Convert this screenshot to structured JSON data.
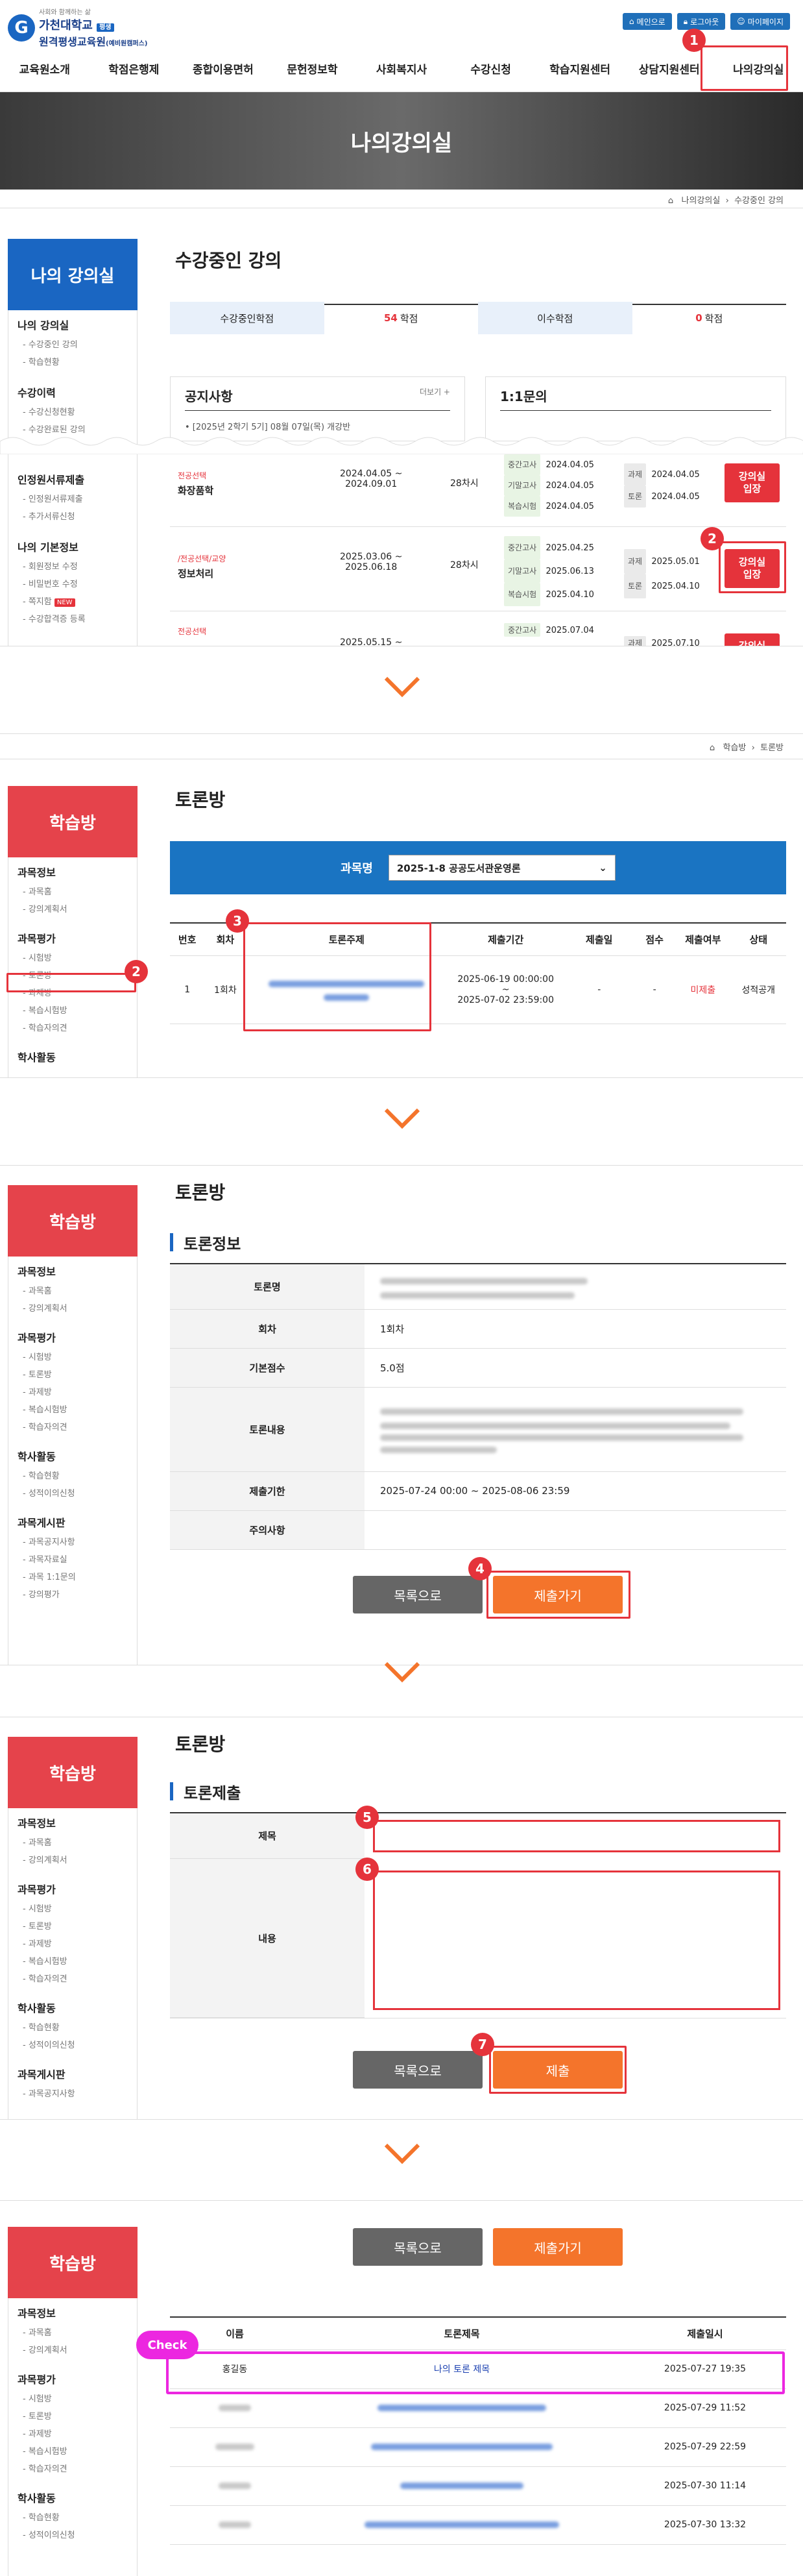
{
  "header": {
    "logo_small": "사회와 함께하는 삶",
    "logo_main": "가천대학교",
    "logo_badge": "평생",
    "logo_sub": "원격평생교육원",
    "logo_sub2": "(예비원캠퍼스)",
    "btn1": "메인으로",
    "btn2": "로그아웃",
    "btn3": "마이페이지"
  },
  "nav": [
    "교육원소개",
    "학점은행제",
    "종합이용면허",
    "문헌정보학",
    "사회복지사",
    "수강신청",
    "학습지원센터",
    "상담지원센터",
    "나의강의실"
  ],
  "banner_title": "나의강의실",
  "s1": {
    "crumb1": "나의강의실",
    "crumb2": "수강중인 강의",
    "side_title": "나의 강의실",
    "side": [
      {
        "g": "나의 강의실",
        "items": [
          "수강중인 강의",
          "학습현황"
        ]
      },
      {
        "g": "수강이력",
        "items": [
          "수강신청현황",
          "수강완료된 강의"
        ]
      },
      {
        "g": "인정원서류제출",
        "items": [
          "인정원서류제출",
          "추가서류신청"
        ]
      },
      {
        "g": "나의 기본정보",
        "items": [
          "회원정보 수정",
          "비밀번호 수정",
          "쪽지함",
          "수강합격증 등록"
        ]
      }
    ],
    "new_badge": "NEW",
    "title": "수강중인 강의",
    "credit_l": "수강중인학점",
    "credit_lv": "54",
    "credit_unit": "학점",
    "credit_r": "이수학점",
    "credit_rv": "0",
    "credit_unit2": "학점",
    "notice_title": "공지사항",
    "more": "더보기 +",
    "notice_item": "• [2025년 2학기 5기] 08월 07일(목) 개강반",
    "qa_title": "1:1문의",
    "rows": [
      {
        "cat": "전공선택",
        "name": "화장품학",
        "period1": "2024.04.05 ~",
        "period2": "2024.09.01",
        "sessions": "28차시",
        "tags": [
          "중간고사",
          "기말고사",
          "복습시험"
        ],
        "tdates": [
          "2024.04.05",
          "2024.04.05",
          "2024.04.05"
        ],
        "tags2": [
          "과제",
          "토론"
        ],
        "t2dates": [
          "2024.04.05",
          "2024.04.05"
        ],
        "btn": "강의실\n입장"
      },
      {
        "cat": "/전공선택/교양",
        "name": "정보처리",
        "period1": "2025.03.06 ~",
        "period2": "2025.06.18",
        "sessions": "28차시",
        "tags": [
          "중간고사",
          "기말고사",
          "복습시험"
        ],
        "tdates": [
          "2025.04.25",
          "2025.06.13",
          "2025.04.10"
        ],
        "tags2": [
          "과제",
          "토론"
        ],
        "t2dates": [
          "2025.05.01",
          "2025.04.10"
        ],
        "btn": "강의실\n입장"
      },
      {
        "cat": "전공선택",
        "name": "",
        "period1": "2025.05.15 ~",
        "period2": "",
        "sessions": "",
        "tags": [
          "중간고사"
        ],
        "tdates": [
          "2025.07.04"
        ],
        "tags2": [
          "과제"
        ],
        "t2dates": [
          "2025.07.10"
        ],
        "btn": "강의실"
      }
    ]
  },
  "learn": {
    "side_title": "학습방",
    "crumb1": "학습방",
    "crumb2": "토론방"
  },
  "s2": {
    "side": [
      {
        "g": "과목정보",
        "items": [
          "과목홈",
          "강의계획서"
        ]
      },
      {
        "g": "과목평가",
        "items": [
          "시험방",
          "토론방",
          "과제방",
          "복습시험방",
          "학습자의견"
        ]
      },
      {
        "g": "학사활동",
        "items": []
      }
    ],
    "title": "토론방",
    "subject_label": "과목명",
    "subject_value": "2025-1-8 공공도서관운영론",
    "cols": [
      "번호",
      "회차",
      "토론주제",
      "제출기간",
      "제출일",
      "점수",
      "제출여부",
      "상태"
    ],
    "row": {
      "no": "1",
      "round": "1회차",
      "p1": "2025-06-19 00:00:00",
      "p2": "~",
      "p3": "2025-07-02 23:59:00",
      "date": "-",
      "score": "-",
      "status": "미제출",
      "state": "성적공개"
    }
  },
  "s3": {
    "side": [
      {
        "g": "과목정보",
        "items": [
          "과목홈",
          "강의계획서"
        ]
      },
      {
        "g": "과목평가",
        "items": [
          "시험방",
          "토론방",
          "과제방",
          "복습시험방",
          "학습자의견"
        ]
      },
      {
        "g": "학사활동",
        "items": [
          "학습현황",
          "성적이의신청"
        ]
      },
      {
        "g": "과목게시판",
        "items": [
          "과목공지사항",
          "과목자료실",
          "과목 1:1문의",
          "강의평가"
        ]
      }
    ],
    "title": "토론방",
    "sub": "토론정보",
    "labels": [
      "토론명",
      "회차",
      "기본점수",
      "토론내용",
      "제출기한",
      "주의사항"
    ],
    "round": "1회차",
    "score": "5.0점",
    "deadline": "2025-07-24 00:00 ~ 2025-08-06 23:59",
    "btn_list": "목록으로",
    "btn_submit": "제출가기"
  },
  "s4": {
    "side": [
      {
        "g": "과목정보",
        "items": [
          "과목홈",
          "강의계획서"
        ]
      },
      {
        "g": "과목평가",
        "items": [
          "시험방",
          "토론방",
          "과제방",
          "복습시험방",
          "학습자의견"
        ]
      },
      {
        "g": "학사활동",
        "items": [
          "학습현황",
          "성적이의신청"
        ]
      },
      {
        "g": "과목게시판",
        "items": [
          "과목공지사항"
        ]
      }
    ],
    "title": "토론방",
    "sub": "토론제출",
    "label_title": "제목",
    "label_content": "내용",
    "btn_list": "목록으로",
    "btn_submit": "제출"
  },
  "s5": {
    "side": [
      {
        "g": "과목정보",
        "items": [
          "과목홈",
          "강의계획서"
        ]
      },
      {
        "g": "과목평가",
        "items": [
          "시험방",
          "토론방",
          "과제방",
          "복습시험방",
          "학습자의견"
        ]
      },
      {
        "g": "학사활동",
        "items": [
          "학습현황",
          "성적이의신청"
        ]
      }
    ],
    "btn_list": "목록으로",
    "btn_submit": "제출가기",
    "check": "Check",
    "cols": [
      "이름",
      "토론제목",
      "제출일시"
    ],
    "rows": [
      {
        "name": "홍길동",
        "title": "나의 토론 제목",
        "date": "2025-07-27 19:35"
      },
      {
        "name": "",
        "title": "",
        "date": "2025-07-29 11:52"
      },
      {
        "name": "",
        "title": "",
        "date": "2025-07-29 22:59"
      },
      {
        "name": "",
        "title": "",
        "date": "2025-07-30 11:14"
      },
      {
        "name": "",
        "title": "",
        "date": "2025-07-30 13:32"
      }
    ]
  },
  "markers": [
    "1",
    "2",
    "2",
    "3",
    "2",
    "4",
    "5",
    "6",
    "7"
  ]
}
